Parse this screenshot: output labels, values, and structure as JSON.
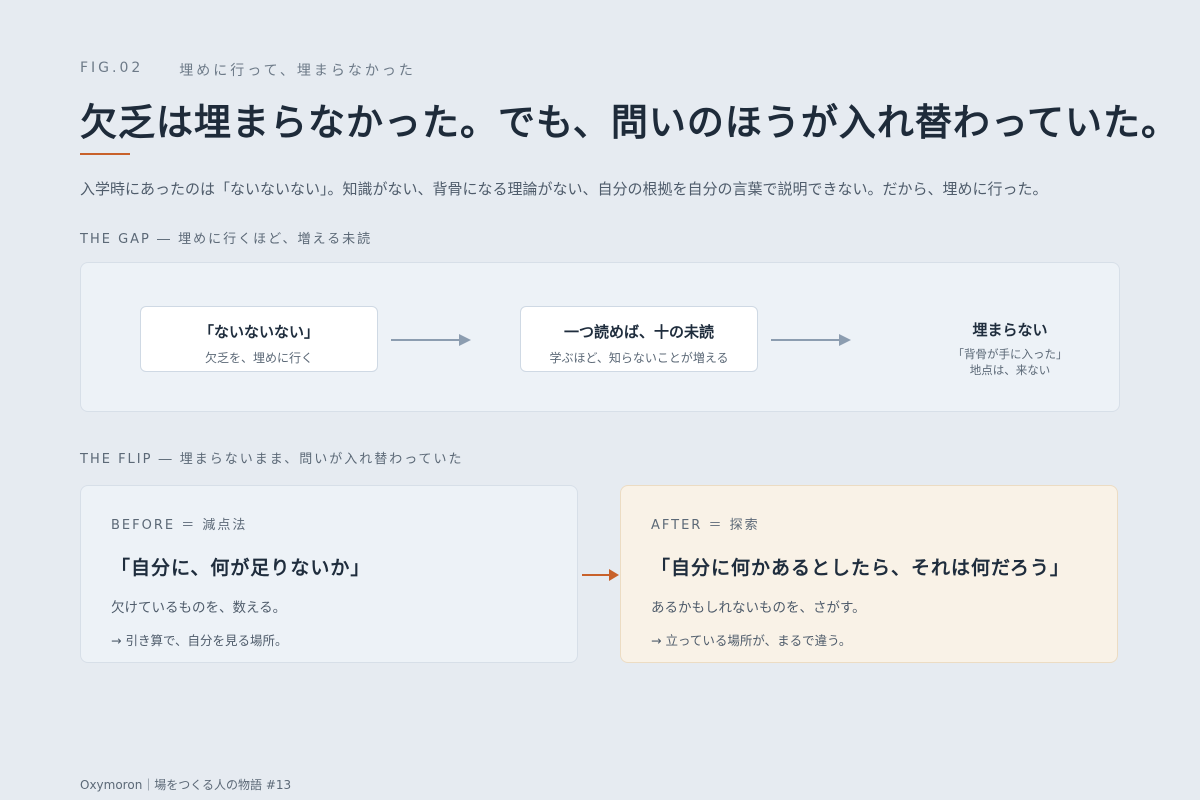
{
  "header": {
    "fig_label": "FIG.02",
    "fig_subtitle": "埋めに行って、埋まらなかった",
    "title": "欠乏は埋まらなかった。でも、問いのほうが入れ替わっていた。",
    "lead": "入学時にあったのは「ないないない」。知識がない、背骨になる理論がない、自分の根拠を自分の言葉で説明できない。だから、埋めに行った。"
  },
  "gap": {
    "section_label": "THE GAP ― 埋めに行くほど、増える未読",
    "steps": [
      {
        "title": "「ないないない」",
        "sub": "欠乏を、埋めに行く"
      },
      {
        "title": "一つ読めば、十の未読",
        "sub": "学ぶほど、知らないことが増える"
      }
    ],
    "end": {
      "title": "埋まらない",
      "sub1": "「背骨が手に入った」",
      "sub2": "地点は、来ない"
    }
  },
  "flip": {
    "section_label": "THE FLIP ― 埋まらないまま、問いが入れ替わっていた",
    "before": {
      "label": "BEFORE ＝ 減点法",
      "quote": "「自分に、何が足りないか」",
      "line1": "欠けているものを、数える。",
      "line2": "→ 引き算で、自分を見る場所。"
    },
    "after": {
      "label": "AFTER ＝ 探索",
      "quote": "「自分に何かあるとしたら、それは何だろう」",
      "line1": "あるかもしれないものを、さがす。",
      "line2": "→ 立っている場所が、まるで違う。"
    }
  },
  "footer": "Oxymoron｜場をつくる人の物語 #13",
  "colors": {
    "accent": "#c8612b",
    "arrow": "#8c9db0",
    "background": "#e6ebf1",
    "after_bg": "#f9f2e7"
  }
}
